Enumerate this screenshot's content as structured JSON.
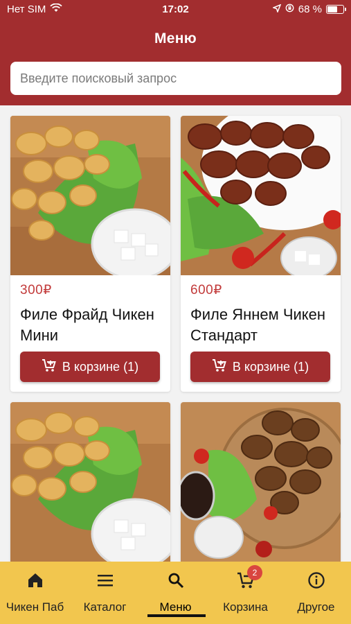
{
  "status": {
    "carrier": "Нет SIM",
    "time": "17:02",
    "battery_text": "68 %",
    "battery_level": 0.68
  },
  "header": {
    "title": "Меню"
  },
  "search": {
    "placeholder": "Введите поисковый запрос"
  },
  "products": [
    {
      "price": "300₽",
      "name": "Филе Фрайд Чикен Мини",
      "button": "В корзине (1)"
    },
    {
      "price": "600₽",
      "name": "Филе Яннем Чикен Стандарт",
      "button": "В корзине (1)"
    }
  ],
  "tabbar": {
    "items": [
      {
        "label": "Чикен Паб",
        "icon": "home-icon"
      },
      {
        "label": "Каталог",
        "icon": "menu-icon"
      },
      {
        "label": "Меню",
        "icon": "search-icon"
      },
      {
        "label": "Корзина",
        "icon": "cart-icon"
      },
      {
        "label": "Другое",
        "icon": "info-icon"
      }
    ],
    "active_index": 2,
    "cart_badge": "2"
  },
  "colors": {
    "brand": "#a22d2f",
    "tabbar": "#f2c64e",
    "price": "#c23a3a",
    "badge": "#d9453f"
  }
}
